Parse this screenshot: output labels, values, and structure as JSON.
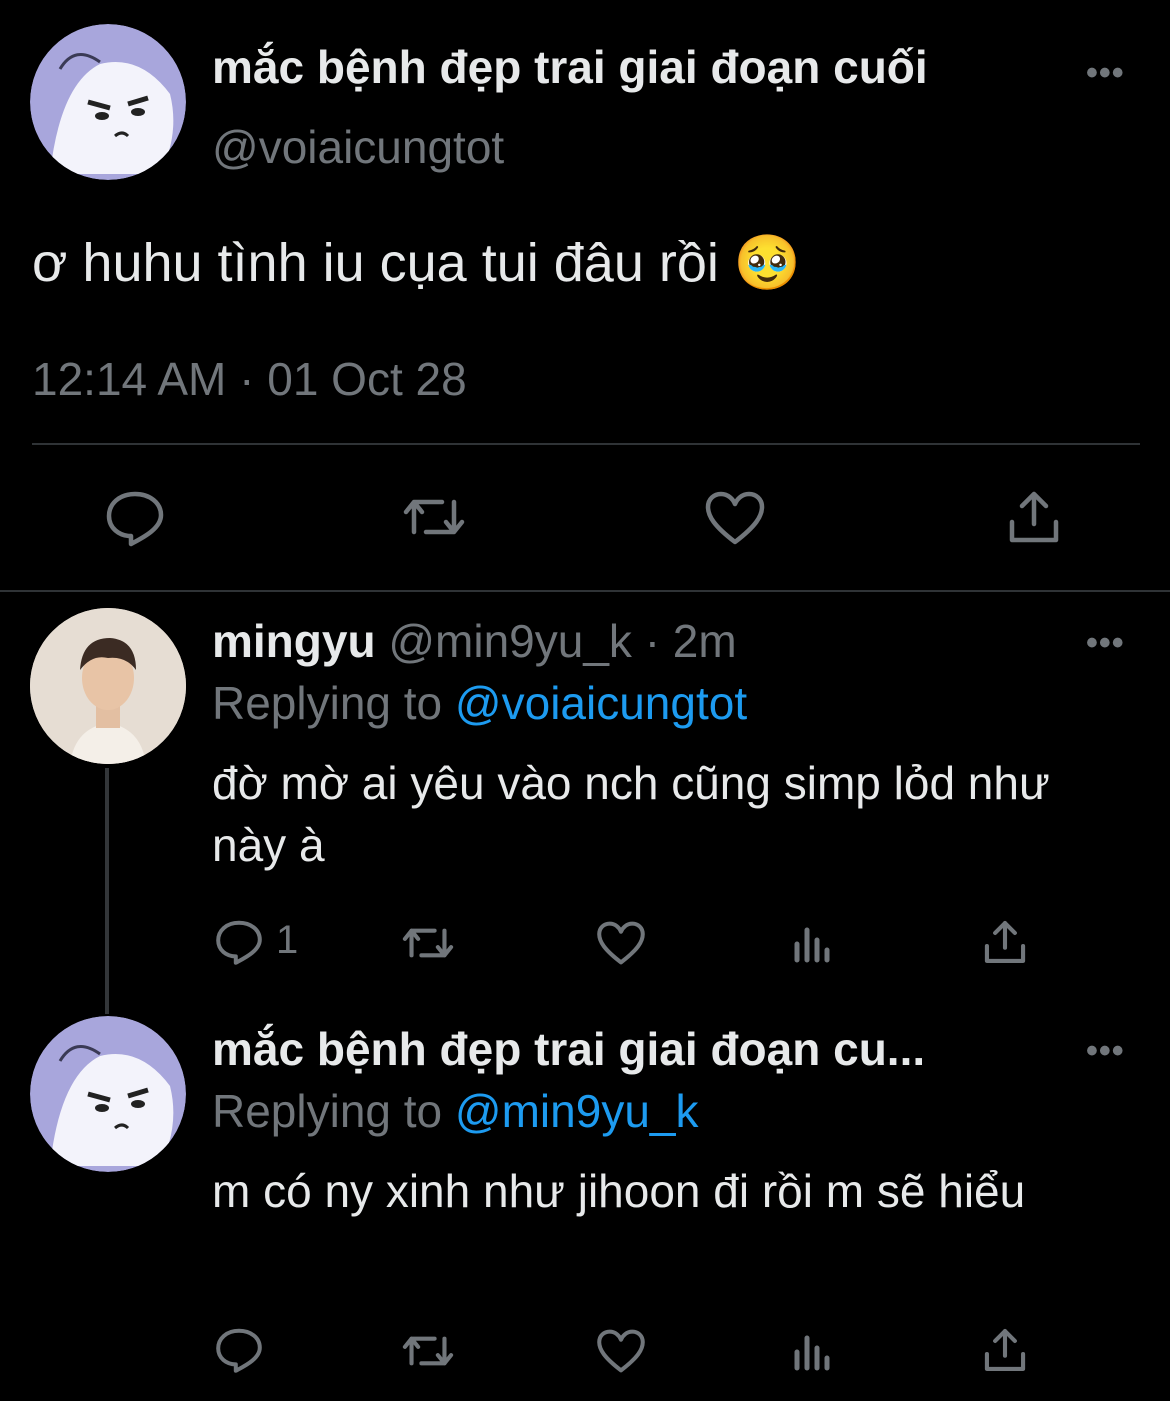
{
  "main_tweet": {
    "display_name": "mắc bệnh đẹp trai giai đoạn cuối",
    "handle": "@voiaicungtot",
    "text": "ơ huhu tình iu cụa tui đâu rồi",
    "emoji": "🥹",
    "timestamp": "12:14 AM · 01 Oct 28",
    "more_label": "•••",
    "actions": [
      "reply-icon",
      "retweet-icon",
      "like-icon",
      "share-icon"
    ]
  },
  "replies": [
    {
      "display_name": "mingyu",
      "handle": "@min9yu_k",
      "time": "· 2m",
      "replying_prefix": "Replying to",
      "replying_to": "@voiaicungtot",
      "text": "đờ mờ ai yêu vào nch cũng simp lỏd như này à",
      "reply_count": "1",
      "more_label": "•••"
    },
    {
      "display_name": "mắc bệnh đẹp trai giai đoạn cu...",
      "replying_prefix": "Replying to",
      "replying_to": "@min9yu_k",
      "text": "m có ny xinh như jihoon đi rồi m sẽ hiểu",
      "more_label": "•••"
    }
  ],
  "colors": {
    "background": "#000000",
    "text": "#e7e9ea",
    "secondary": "#71767b",
    "accent": "#1d9bf0",
    "divider": "#2f3336"
  }
}
